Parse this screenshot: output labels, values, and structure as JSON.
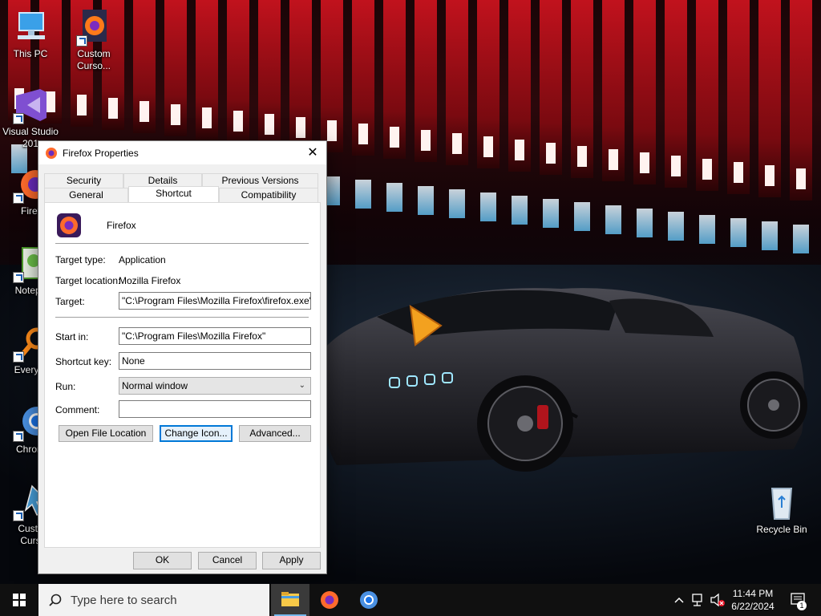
{
  "desktop": {
    "icons": [
      {
        "label": "This PC",
        "icon": "computer-icon"
      },
      {
        "label": "Custom\nCurso...",
        "icon": "firefox-icon"
      },
      {
        "label": "Visual Studio\n201",
        "icon": "visual-studio-icon"
      },
      {
        "label": "Firef",
        "icon": "firefox-icon"
      },
      {
        "label": "Notepa",
        "icon": "notepad-icon"
      },
      {
        "label": "Everyth",
        "icon": "search-icon"
      },
      {
        "label": "Chrom",
        "icon": "chrome-icon"
      },
      {
        "label": "Custo\nCurs",
        "icon": "cursor-icon"
      },
      {
        "label": "Recycle Bin",
        "icon": "recycle-bin-icon"
      }
    ]
  },
  "dialog": {
    "title": "Firefox Properties",
    "tabs_row1": [
      "Security",
      "Details",
      "Previous Versions"
    ],
    "tabs_row2": [
      "General",
      "Shortcut",
      "Compatibility"
    ],
    "active_tab": "Shortcut",
    "app_name": "Firefox",
    "target_type_label": "Target type:",
    "target_type_value": "Application",
    "target_location_label": "Target location:",
    "target_location_value": "Mozilla Firefox",
    "target_label": "Target:",
    "target_value": "\"C:\\Program Files\\Mozilla Firefox\\firefox.exe\"",
    "start_in_label": "Start in:",
    "start_in_value": "\"C:\\Program Files\\Mozilla Firefox\"",
    "shortcut_key_label": "Shortcut key:",
    "shortcut_key_value": "None",
    "run_label": "Run:",
    "run_value": "Normal window",
    "comment_label": "Comment:",
    "comment_value": "",
    "open_file_location_label": "Open File Location",
    "change_icon_label": "Change Icon...",
    "advanced_label": "Advanced...",
    "ok_label": "OK",
    "cancel_label": "Cancel",
    "apply_label": "Apply"
  },
  "taskbar": {
    "search_placeholder": "Type here to search",
    "time": "11:44 PM",
    "date": "6/22/2024",
    "notification_count": "1"
  },
  "colors": {
    "accent": "#0078d7",
    "taskbar": "#101010",
    "dialog_bg": "#f0f0f0"
  }
}
